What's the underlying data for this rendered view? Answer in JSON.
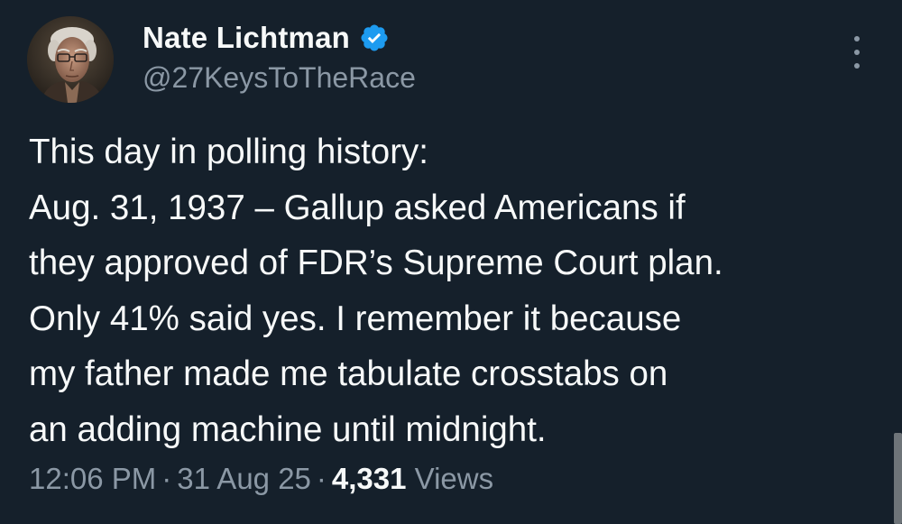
{
  "author": {
    "display_name": "Nate Lichtman",
    "handle": "@27KeysToTheRace",
    "verified_icon": "verified-badge-icon",
    "avatar_description": "avatar"
  },
  "tweet": {
    "lines": [
      "This day in polling history:",
      "Aug. 31, 1937 – Gallup asked Americans if",
      "they approved of FDR’s Supreme Court plan.",
      "Only 41% said yes. I remember it because",
      "my father made me tabulate crosstabs on",
      "an adding machine until midnight."
    ]
  },
  "meta": {
    "time": "12:06 PM",
    "separator": "·",
    "date": "31 Aug 25",
    "views_count": "4,331",
    "views_label": "Views"
  },
  "colors": {
    "background": "#15202b",
    "text_primary": "#f7f9f9",
    "text_secondary": "#8b98a5",
    "verified_blue": "#1d9bf0"
  },
  "icons": {
    "more": "more-vertical-icon",
    "verified": "verified-badge-icon"
  }
}
